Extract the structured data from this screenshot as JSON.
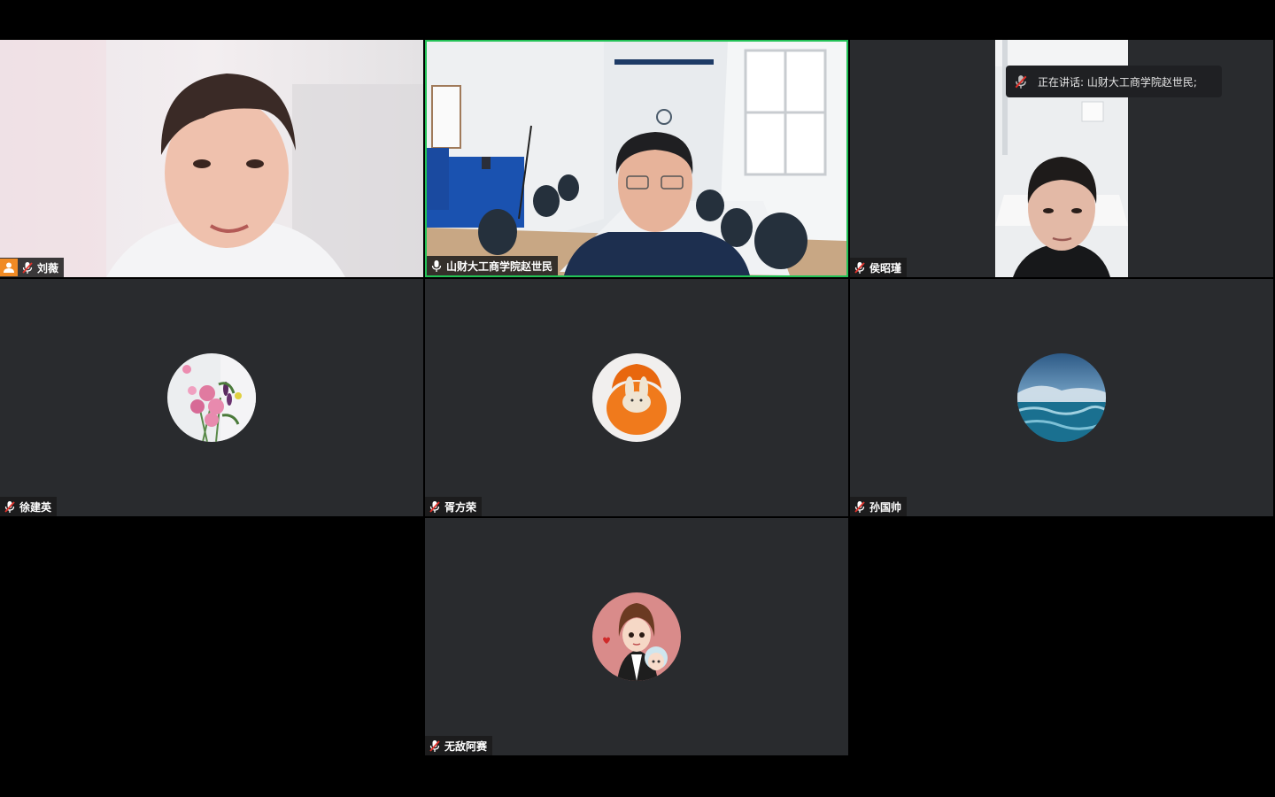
{
  "participants": [
    {
      "name": "刘薇",
      "host": true,
      "muted": true
    },
    {
      "name": "山财大工商学院赵世民",
      "host": false,
      "muted": false,
      "speaking": true
    },
    {
      "name": "侯昭瑾",
      "host": false,
      "muted": true
    },
    {
      "name": "徐建英",
      "host": false,
      "muted": true
    },
    {
      "name": "胥方荣",
      "host": false,
      "muted": true
    },
    {
      "name": "孙国帅",
      "host": false,
      "muted": true
    },
    {
      "name": "无敌阿赛",
      "host": false,
      "muted": true
    }
  ],
  "speaking_notice": {
    "text": "正在讲话: 山财大工商学院赵世民;"
  },
  "colors": {
    "speaking_border": "#23c257",
    "tile_bg": "#292b2e",
    "host_badge": "#f08a24",
    "muted_mic": "#e0312a"
  }
}
